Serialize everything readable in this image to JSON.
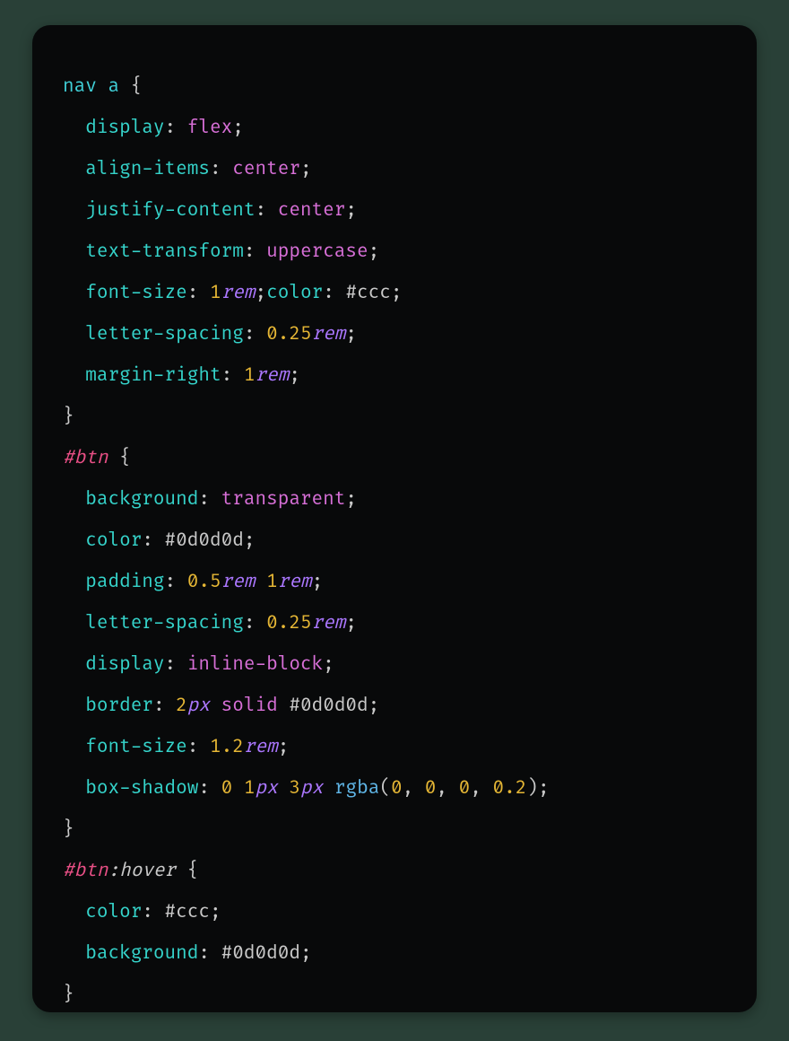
{
  "code": {
    "tokens": [
      {
        "cls": "c-sel",
        "txt": "nav a"
      },
      {
        "cls": "c-pn",
        "txt": " {"
      },
      {
        "br": 1
      },
      {
        "txt": "  "
      },
      {
        "cls": "c-prop",
        "txt": "display"
      },
      {
        "cls": "c-pn",
        "txt": ": "
      },
      {
        "cls": "c-kw",
        "txt": "flex"
      },
      {
        "cls": "c-pn",
        "txt": ";"
      },
      {
        "br": 1
      },
      {
        "txt": "  "
      },
      {
        "cls": "c-prop",
        "txt": "align-items"
      },
      {
        "cls": "c-pn",
        "txt": ": "
      },
      {
        "cls": "c-kw",
        "txt": "center"
      },
      {
        "cls": "c-pn",
        "txt": ";"
      },
      {
        "br": 1
      },
      {
        "txt": "  "
      },
      {
        "cls": "c-prop",
        "txt": "justify-content"
      },
      {
        "cls": "c-pn",
        "txt": ": "
      },
      {
        "cls": "c-kw",
        "txt": "center"
      },
      {
        "cls": "c-pn",
        "txt": ";"
      },
      {
        "br": 1
      },
      {
        "txt": "  "
      },
      {
        "cls": "c-prop",
        "txt": "text-transform"
      },
      {
        "cls": "c-pn",
        "txt": ": "
      },
      {
        "cls": "c-kw",
        "txt": "uppercase"
      },
      {
        "cls": "c-pn",
        "txt": ";"
      },
      {
        "br": 1
      },
      {
        "txt": "  "
      },
      {
        "cls": "c-prop",
        "txt": "font-size"
      },
      {
        "cls": "c-pn",
        "txt": ": "
      },
      {
        "cls": "c-num",
        "txt": "1"
      },
      {
        "cls": "c-unit",
        "txt": "rem"
      },
      {
        "cls": "c-pn",
        "txt": ";"
      },
      {
        "cls": "c-prop",
        "txt": "color"
      },
      {
        "cls": "c-pn",
        "txt": ": "
      },
      {
        "cls": "c-hex",
        "txt": "#ccc"
      },
      {
        "cls": "c-pn",
        "txt": ";"
      },
      {
        "br": 1
      },
      {
        "txt": "  "
      },
      {
        "cls": "c-prop",
        "txt": "letter-spacing"
      },
      {
        "cls": "c-pn",
        "txt": ": "
      },
      {
        "cls": "c-num",
        "txt": "0.25"
      },
      {
        "cls": "c-unit",
        "txt": "rem"
      },
      {
        "cls": "c-pn",
        "txt": ";"
      },
      {
        "br": 1
      },
      {
        "txt": "  "
      },
      {
        "cls": "c-prop",
        "txt": "margin-right"
      },
      {
        "cls": "c-pn",
        "txt": ": "
      },
      {
        "cls": "c-num",
        "txt": "1"
      },
      {
        "cls": "c-unit",
        "txt": "rem"
      },
      {
        "cls": "c-pn",
        "txt": ";"
      },
      {
        "br": 1
      },
      {
        "cls": "c-pn",
        "txt": "}"
      },
      {
        "br": 1
      },
      {
        "cls": "c-id",
        "txt": "#btn"
      },
      {
        "cls": "c-pn",
        "txt": " {"
      },
      {
        "br": 1
      },
      {
        "txt": "  "
      },
      {
        "cls": "c-prop",
        "txt": "background"
      },
      {
        "cls": "c-pn",
        "txt": ": "
      },
      {
        "cls": "c-kw",
        "txt": "transparent"
      },
      {
        "cls": "c-pn",
        "txt": ";"
      },
      {
        "br": 1
      },
      {
        "txt": "  "
      },
      {
        "cls": "c-prop",
        "txt": "color"
      },
      {
        "cls": "c-pn",
        "txt": ": "
      },
      {
        "cls": "c-hex",
        "txt": "#0d0d0d"
      },
      {
        "cls": "c-pn",
        "txt": ";"
      },
      {
        "br": 1
      },
      {
        "txt": "  "
      },
      {
        "cls": "c-prop",
        "txt": "padding"
      },
      {
        "cls": "c-pn",
        "txt": ": "
      },
      {
        "cls": "c-num",
        "txt": "0.5"
      },
      {
        "cls": "c-unit",
        "txt": "rem"
      },
      {
        "txt": " "
      },
      {
        "cls": "c-num",
        "txt": "1"
      },
      {
        "cls": "c-unit",
        "txt": "rem"
      },
      {
        "cls": "c-pn",
        "txt": ";"
      },
      {
        "br": 1
      },
      {
        "txt": "  "
      },
      {
        "cls": "c-prop",
        "txt": "letter-spacing"
      },
      {
        "cls": "c-pn",
        "txt": ": "
      },
      {
        "cls": "c-num",
        "txt": "0.25"
      },
      {
        "cls": "c-unit",
        "txt": "rem"
      },
      {
        "cls": "c-pn",
        "txt": ";"
      },
      {
        "br": 1
      },
      {
        "txt": "  "
      },
      {
        "cls": "c-prop",
        "txt": "display"
      },
      {
        "cls": "c-pn",
        "txt": ": "
      },
      {
        "cls": "c-kw",
        "txt": "inline-block"
      },
      {
        "cls": "c-pn",
        "txt": ";"
      },
      {
        "br": 1
      },
      {
        "txt": "  "
      },
      {
        "cls": "c-prop",
        "txt": "border"
      },
      {
        "cls": "c-pn",
        "txt": ": "
      },
      {
        "cls": "c-num",
        "txt": "2"
      },
      {
        "cls": "c-unit",
        "txt": "px"
      },
      {
        "txt": " "
      },
      {
        "cls": "c-kw",
        "txt": "solid"
      },
      {
        "txt": " "
      },
      {
        "cls": "c-hex",
        "txt": "#0d0d0d"
      },
      {
        "cls": "c-pn",
        "txt": ";"
      },
      {
        "br": 1
      },
      {
        "txt": "  "
      },
      {
        "cls": "c-prop",
        "txt": "font-size"
      },
      {
        "cls": "c-pn",
        "txt": ": "
      },
      {
        "cls": "c-num",
        "txt": "1.2"
      },
      {
        "cls": "c-unit",
        "txt": "rem"
      },
      {
        "cls": "c-pn",
        "txt": ";"
      },
      {
        "br": 1
      },
      {
        "txt": "  "
      },
      {
        "cls": "c-prop",
        "txt": "box-shadow"
      },
      {
        "cls": "c-pn",
        "txt": ": "
      },
      {
        "cls": "c-num",
        "txt": "0"
      },
      {
        "txt": " "
      },
      {
        "cls": "c-num",
        "txt": "1"
      },
      {
        "cls": "c-unit",
        "txt": "px"
      },
      {
        "txt": " "
      },
      {
        "cls": "c-num",
        "txt": "3"
      },
      {
        "cls": "c-unit",
        "txt": "px"
      },
      {
        "txt": " "
      },
      {
        "cls": "c-fn",
        "txt": "rgba"
      },
      {
        "cls": "c-pn",
        "txt": "("
      },
      {
        "cls": "c-num",
        "txt": "0"
      },
      {
        "cls": "c-pn",
        "txt": ", "
      },
      {
        "cls": "c-num",
        "txt": "0"
      },
      {
        "cls": "c-pn",
        "txt": ", "
      },
      {
        "cls": "c-num",
        "txt": "0"
      },
      {
        "cls": "c-pn",
        "txt": ", "
      },
      {
        "cls": "c-num",
        "txt": "0.2"
      },
      {
        "cls": "c-pn",
        "txt": ");"
      },
      {
        "br": 1
      },
      {
        "cls": "c-pn",
        "txt": "}"
      },
      {
        "br": 1
      },
      {
        "cls": "c-id",
        "txt": "#btn"
      },
      {
        "cls": "c-psd",
        "txt": ":hover"
      },
      {
        "cls": "c-pn",
        "txt": " {"
      },
      {
        "br": 1
      },
      {
        "txt": "  "
      },
      {
        "cls": "c-prop",
        "txt": "color"
      },
      {
        "cls": "c-pn",
        "txt": ": "
      },
      {
        "cls": "c-hex",
        "txt": "#ccc"
      },
      {
        "cls": "c-pn",
        "txt": ";"
      },
      {
        "br": 1
      },
      {
        "txt": "  "
      },
      {
        "cls": "c-prop",
        "txt": "background"
      },
      {
        "cls": "c-pn",
        "txt": ": "
      },
      {
        "cls": "c-hex",
        "txt": "#0d0d0d"
      },
      {
        "cls": "c-pn",
        "txt": ";"
      },
      {
        "br": 1
      },
      {
        "cls": "c-pn",
        "txt": "}"
      }
    ]
  }
}
